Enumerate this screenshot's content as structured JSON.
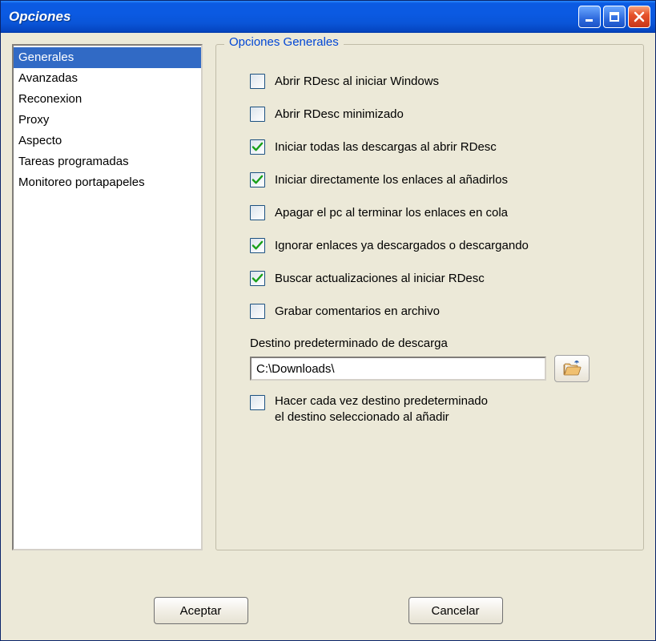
{
  "window": {
    "title": "Opciones"
  },
  "sidebar": {
    "items": [
      {
        "label": "Generales",
        "selected": true
      },
      {
        "label": "Avanzadas",
        "selected": false
      },
      {
        "label": "Reconexion",
        "selected": false
      },
      {
        "label": "Proxy",
        "selected": false
      },
      {
        "label": "Aspecto",
        "selected": false
      },
      {
        "label": "Tareas programadas",
        "selected": false
      },
      {
        "label": "Monitoreo portapapeles",
        "selected": false
      }
    ]
  },
  "panel": {
    "title": "Opciones Generales",
    "checks": [
      {
        "label": "Abrir RDesc al iniciar Windows",
        "checked": false
      },
      {
        "label": "Abrir RDesc minimizado",
        "checked": false
      },
      {
        "label": "Iniciar todas las descargas al abrir RDesc",
        "checked": true
      },
      {
        "label": "Iniciar directamente los enlaces al añadirlos",
        "checked": true
      },
      {
        "label": "Apagar el pc al terminar los enlaces en cola",
        "checked": false
      },
      {
        "label": "Ignorar enlaces ya descargados o descargando",
        "checked": true
      },
      {
        "label": "Buscar actualizaciones al iniciar RDesc",
        "checked": true
      },
      {
        "label": "Grabar comentarios en archivo",
        "checked": false
      }
    ],
    "dest_label": "Destino predeterminado de descarga",
    "dest_value": "C:\\Downloads\\",
    "final_check": {
      "label_line1": "Hacer cada vez destino predeterminado",
      "label_line2": "el destino seleccionado al añadir",
      "checked": false
    }
  },
  "buttons": {
    "ok": "Aceptar",
    "cancel": "Cancelar"
  }
}
